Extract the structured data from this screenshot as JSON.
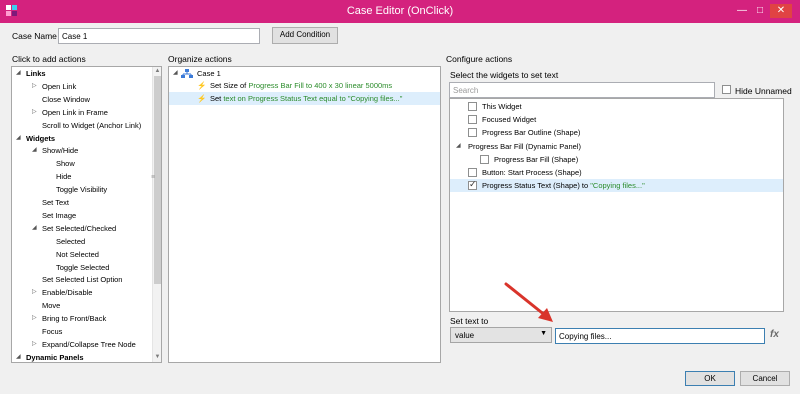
{
  "window": {
    "title": "Case Editor (OnClick)",
    "minimize": "—",
    "maximize": "□",
    "close": "✕"
  },
  "case": {
    "label": "Case Name",
    "value": "Case 1",
    "add_condition": "Add Condition"
  },
  "left": {
    "header": "Click to add actions",
    "items": [
      {
        "label": "Links",
        "level": 0,
        "expand": "open",
        "bold": true
      },
      {
        "label": "Open Link",
        "level": 1,
        "expand": "closed"
      },
      {
        "label": "Close Window",
        "level": 1,
        "expand": "none"
      },
      {
        "label": "Open Link in Frame",
        "level": 1,
        "expand": "closed"
      },
      {
        "label": "Scroll to Widget (Anchor Link)",
        "level": 1,
        "expand": "none"
      },
      {
        "label": "Widgets",
        "level": 0,
        "expand": "open",
        "bold": true
      },
      {
        "label": "Show/Hide",
        "level": 1,
        "expand": "open"
      },
      {
        "label": "Show",
        "level": 2,
        "expand": "none"
      },
      {
        "label": "Hide",
        "level": 2,
        "expand": "none"
      },
      {
        "label": "Toggle Visibility",
        "level": 2,
        "expand": "none"
      },
      {
        "label": "Set Text",
        "level": 1,
        "expand": "none"
      },
      {
        "label": "Set Image",
        "level": 1,
        "expand": "none"
      },
      {
        "label": "Set Selected/Checked",
        "level": 1,
        "expand": "open"
      },
      {
        "label": "Selected",
        "level": 2,
        "expand": "none"
      },
      {
        "label": "Not Selected",
        "level": 2,
        "expand": "none"
      },
      {
        "label": "Toggle Selected",
        "level": 2,
        "expand": "none"
      },
      {
        "label": "Set Selected List Option",
        "level": 1,
        "expand": "none"
      },
      {
        "label": "Enable/Disable",
        "level": 1,
        "expand": "closed"
      },
      {
        "label": "Move",
        "level": 1,
        "expand": "none"
      },
      {
        "label": "Bring to Front/Back",
        "level": 1,
        "expand": "closed"
      },
      {
        "label": "Focus",
        "level": 1,
        "expand": "none"
      },
      {
        "label": "Expand/Collapse Tree Node",
        "level": 1,
        "expand": "closed"
      },
      {
        "label": "Dynamic Panels",
        "level": 0,
        "expand": "open",
        "bold": true
      }
    ]
  },
  "middle": {
    "header": "Organize actions",
    "case_node": "Case 1",
    "actions": [
      {
        "prefix": "Set Size of ",
        "detail": "Progress Bar Fill to 400 x 30 linear 5000ms",
        "selected": false
      },
      {
        "prefix": "Set ",
        "detail": "text on Progress Status Text equal to \"Copying files...\"",
        "selected": true
      }
    ]
  },
  "right": {
    "header": "Configure actions",
    "widgets_label": "Select the widgets to set text",
    "search_placeholder": "Search",
    "hide_unnamed": "Hide Unnamed",
    "widgets": [
      {
        "label": "This Widget",
        "checked": false,
        "indent": 1,
        "suffix": ""
      },
      {
        "label": "Focused Widget",
        "checked": false,
        "indent": 1,
        "suffix": ""
      },
      {
        "label": "Progress Bar Outline (Shape)",
        "checked": false,
        "indent": 1,
        "suffix": ""
      },
      {
        "label": "Progress Bar Fill (Dynamic Panel)",
        "checked": null,
        "indent": 0,
        "suffix": ""
      },
      {
        "label": "Progress Bar Fill (Shape)",
        "checked": false,
        "indent": 2,
        "suffix": ""
      },
      {
        "label": "Button: Start Process (Shape)",
        "checked": false,
        "indent": 1,
        "suffix": ""
      },
      {
        "label": "Progress Status Text (Shape) to ",
        "checked": true,
        "indent": 1,
        "suffix": "\"Copying files...\""
      }
    ],
    "set_text_label": "Set text to",
    "type_value": "value",
    "text_value": "Copying files...",
    "fx": "fx"
  },
  "footer": {
    "ok": "OK",
    "cancel": "Cancel"
  },
  "colors": {
    "titlebar": "#d4227e",
    "arrow": "#d9342b",
    "green_text": "#2b8c2b",
    "selection": "#ddeefc"
  }
}
